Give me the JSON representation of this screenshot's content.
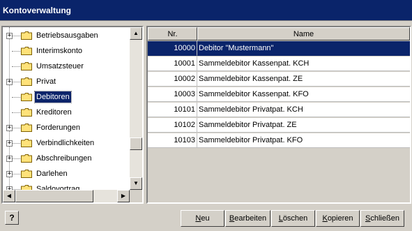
{
  "window": {
    "title": "Kontoverwaltung"
  },
  "tree": {
    "items": [
      {
        "label": "Betriebsausgaben",
        "expandable": true
      },
      {
        "label": "Interimskonto",
        "expandable": false
      },
      {
        "label": "Umsatzsteuer",
        "expandable": false
      },
      {
        "label": "Privat",
        "expandable": true
      },
      {
        "label": "Debitoren",
        "expandable": false,
        "selected": true
      },
      {
        "label": "Kreditoren",
        "expandable": false
      },
      {
        "label": "Forderungen",
        "expandable": true
      },
      {
        "label": "Verbindlichkeiten",
        "expandable": true
      },
      {
        "label": "Abschreibungen",
        "expandable": true
      },
      {
        "label": "Darlehen",
        "expandable": true
      },
      {
        "label": "Saldovortrag",
        "expandable": true
      }
    ]
  },
  "table": {
    "columns": {
      "nr": "Nr.",
      "name": "Name"
    },
    "rows": [
      {
        "nr": "10000",
        "name": "Debitor \"Mustermann\"",
        "selected": true
      },
      {
        "nr": "10001",
        "name": "Sammeldebitor Kassenpat. KCH"
      },
      {
        "nr": "10002",
        "name": "Sammeldebitor Kassenpat. ZE"
      },
      {
        "nr": "10003",
        "name": "Sammeldebitor Kassenpat. KFO"
      },
      {
        "nr": "10101",
        "name": "Sammeldebitor Privatpat. KCH"
      },
      {
        "nr": "10102",
        "name": "Sammeldebitor Privatpat. ZE"
      },
      {
        "nr": "10103",
        "name": "Sammeldebitor Privatpat. KFO"
      }
    ]
  },
  "buttons": {
    "help": "?",
    "neu": {
      "hotkey": "N",
      "rest": "eu"
    },
    "bearbeiten": {
      "hotkey": "B",
      "rest": "earbeiten"
    },
    "loeschen": {
      "hotkey": "L",
      "rest": "öschen"
    },
    "kopieren": {
      "hotkey": "K",
      "rest": "opieren"
    },
    "schliessen": {
      "hotkey": "S",
      "rest": "chließen"
    }
  },
  "colors": {
    "selection": "#0a246a",
    "face": "#d4d0c8",
    "folder": "#ffe27a"
  }
}
